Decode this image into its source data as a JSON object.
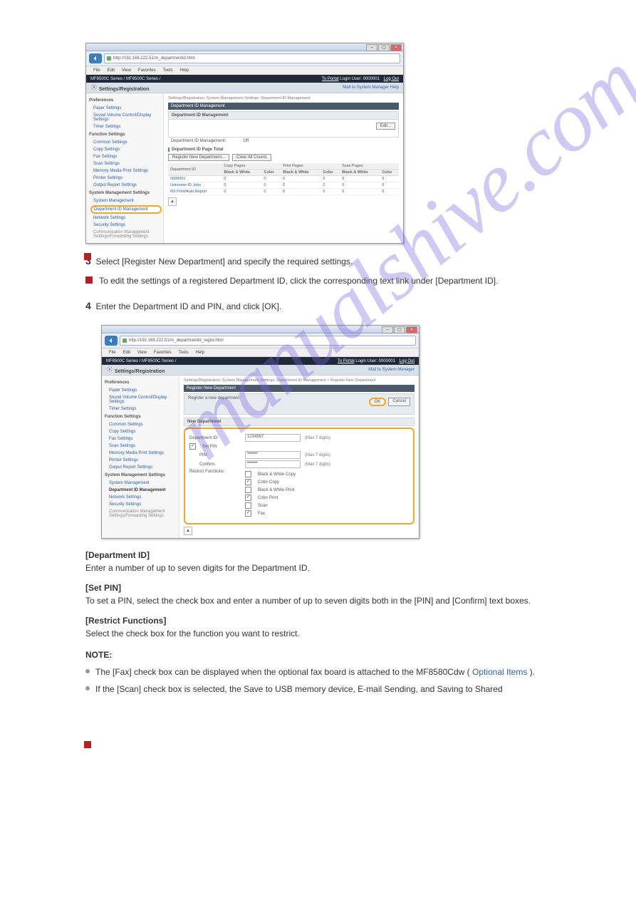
{
  "doc": {
    "step3_heading": "Select [Register New Department] and specify the required settings.",
    "note_edit": "To edit the settings of a registered Department ID, click the corresponding text link under [Department ID].",
    "step4_heading": "Enter the Department ID and PIN, and click [OK].",
    "field_dept_id": "[Department ID]",
    "field_dept_id_desc": "Enter a number of up to seven digits for the Department ID.",
    "field_set_pin": "[Set PIN]",
    "field_set_pin_desc": "To set a PIN, select the check box and enter a number of up to seven digits both in the [PIN] and [Confirm] text boxes.",
    "field_restrict": "[Restrict Functions]",
    "field_restrict_desc": "Select the check box for the function you want to restrict.",
    "note_heading": "NOTE:",
    "note_fax": "The [Fax] check box can be displayed when the optional fax board is attached to the MF8580Cdw (",
    "note_fax_link": "Optional Items",
    "note_fax_tail": ").",
    "note_scan": "If the [Scan] check box is selected, the Save to USB memory device, E-mail Sending, and Saving to Shared"
  },
  "browser": {
    "url1": "http://192.168.222.51/m_departmentid.html",
    "url2": "http://192.168.222.51/m_departmentid_regist.html",
    "menus": [
      "File",
      "Edit",
      "View",
      "Favorites",
      "Tools",
      "Help"
    ]
  },
  "device_bar": {
    "model": "MF8500C Series / MF8500C Series /",
    "to_portal": "To Portal",
    "login_user": "Login User: 0000001",
    "logout": "Log Out"
  },
  "sub_bar": {
    "title": "Settings/Registration",
    "mail_link": "Mail to System Manager",
    "help_link": "Help"
  },
  "sidebar": {
    "prefs": "Preferences",
    "paper": "Paper Settings",
    "sound": "Sound Volume Control/Display Settings",
    "timer": "Timer Settings",
    "func": "Function Settings",
    "common": "Common Settings",
    "copy": "Copy Settings",
    "fax": "Fax Settings",
    "scan": "Scan Settings",
    "memory": "Memory Media Print Settings",
    "printer": "Printer Settings",
    "output": "Output Report Settings",
    "sysmgmt": "System Management Settings",
    "system": "System Management",
    "dept": "Department ID Management",
    "network": "Network Settings",
    "security": "Security Settings",
    "comm": "Communication Management Settings/Forwarding Settings"
  },
  "pane1": {
    "breadcrumb": "Settings/Registration: System Management Settings: Department ID Management",
    "band": "Department ID Management",
    "panel_title": "Department ID Management",
    "edit": "Edit...",
    "kv_label": "Department ID Management:",
    "kv_value": "Off",
    "section": "Department ID Page Total",
    "btn_register": "Register New Department...",
    "btn_clear": "Clear All Counts",
    "th_dept": "Department ID",
    "grp_copy": "Copy Pages",
    "grp_print": "Print Pages",
    "grp_scan": "Scan Pages",
    "th_bw": "Black & White",
    "th_color": "Color",
    "rows": [
      {
        "id": "0000001",
        "v": [
          "0",
          "0",
          "0",
          "0",
          "0",
          "0",
          "0"
        ]
      },
      {
        "id": "Unknown ID Jobs",
        "v": [
          "0",
          "0",
          "0",
          "0",
          "0",
          "0",
          "0"
        ]
      },
      {
        "id": "RX Print/Auto Report",
        "v": [
          "0",
          "0",
          "0",
          "0",
          "0",
          "0",
          "0"
        ]
      }
    ]
  },
  "pane2": {
    "breadcrumb": "Settings/Registration: System Management Settings: Department ID Management > Register New Department",
    "band": "Register New Department",
    "sub_text": "Register a new department.",
    "ok": "OK",
    "cancel": "Cancel",
    "section": "New Department",
    "dept_label": "Department ID:",
    "dept_value": "1234567",
    "max7": "(Max 7 digits)",
    "set_pin": "Set PIN",
    "pin_label": "PIN:",
    "pin_value": "•••••••",
    "confirm_label": "Confirm:",
    "confirm_value": "•••••••",
    "restrict_label": "Restrict Functions:",
    "rf": [
      "Black & White Copy",
      "Color Copy",
      "Black & White Print",
      "Color Print",
      "Scan",
      "Fax"
    ]
  }
}
